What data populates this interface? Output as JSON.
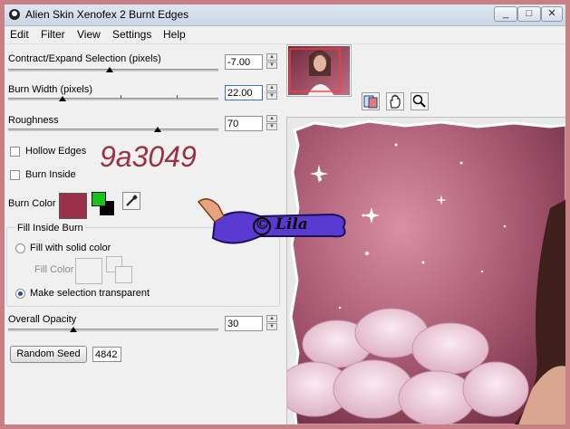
{
  "window": {
    "title": "Alien Skin Xenofex 2 Burnt Edges",
    "controls": [
      "_",
      "□",
      "✕"
    ]
  },
  "menu": [
    "Edit",
    "Filter",
    "View",
    "Settings",
    "Help"
  ],
  "controls": {
    "contract_expand": {
      "label": "Contract/Expand Selection (pixels)",
      "value": "-7.00",
      "slider": 0.45
    },
    "burn_width": {
      "label": "Burn Width (pixels)",
      "value": "22.00",
      "slider": 0.22
    },
    "roughness": {
      "label": "Roughness",
      "value": "70",
      "slider": 0.7
    },
    "hollow_edges": {
      "label": "Hollow Edges",
      "checked": false
    },
    "burn_inside": {
      "label": "Burn Inside",
      "checked": false
    },
    "burn_color": {
      "label": "Burn Color",
      "color": "#9a3049"
    },
    "fill_group": {
      "title": "Fill Inside Burn",
      "option_fill": "Fill with solid color",
      "fill_color_label": "Fill Color",
      "option_transparent": "Make selection transparent",
      "selected": "transparent"
    },
    "overall_opacity": {
      "label": "Overall Opacity",
      "value": "30",
      "slider": 0.3
    },
    "random_seed": {
      "button": "Random Seed",
      "value": "4842"
    }
  },
  "overlay": {
    "hex_text": "9a3049",
    "logo_text": "© Lila"
  },
  "icons": [
    "color-picker-icon",
    "compare-icon",
    "hand-icon",
    "zoom-icon"
  ],
  "colors": {
    "accent": "#9a3049",
    "frame": "#c97f86"
  }
}
